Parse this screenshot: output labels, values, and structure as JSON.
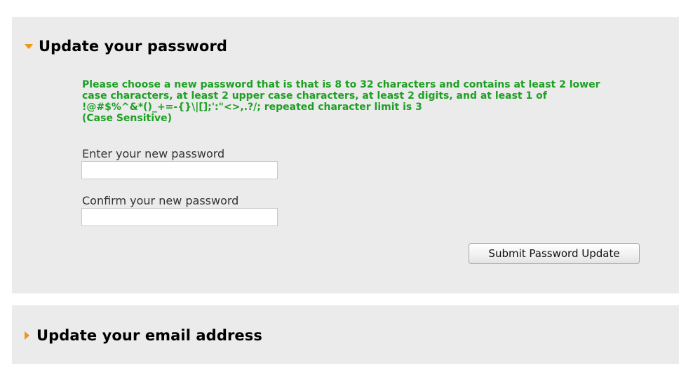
{
  "password_section": {
    "title": "Update your password",
    "expanded": true,
    "instructions": [
      "Please choose a new password that is that is 8 to 32 characters and contains at least 2 lower",
      "case characters, at least 2 upper case characters, at least 2 digits, and at least 1 of",
      "!@#$%^&*()_+=-{}\\|[];':\"<>,.?/; repeated character limit is 3",
      "(Case Sensitive)"
    ],
    "new_password": {
      "label": "Enter your new password",
      "value": ""
    },
    "confirm_password": {
      "label": "Confirm your new password",
      "value": ""
    },
    "submit_label": "Submit Password Update"
  },
  "email_section": {
    "title": "Update your email address",
    "expanded": false
  },
  "colors": {
    "accent_arrow": "#f0960f",
    "instruction_text": "#1ea024",
    "panel_background": "#ebebeb"
  },
  "icons": {
    "expanded": "caret-down-icon",
    "collapsed": "caret-right-icon"
  }
}
